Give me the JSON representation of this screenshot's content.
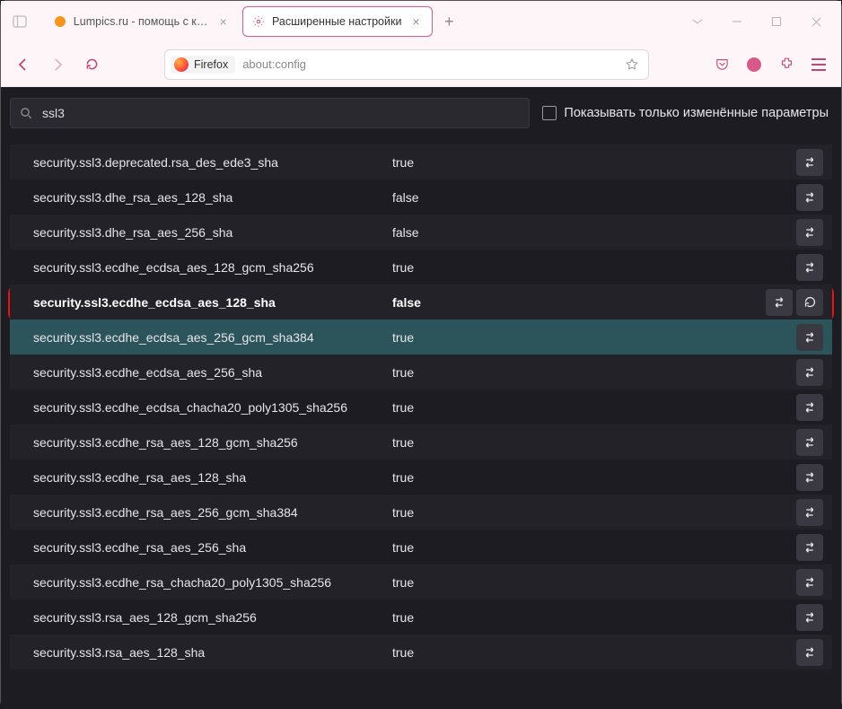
{
  "titlebar": {
    "tabs": [
      {
        "label": "Lumpics.ru - помощь с компь",
        "active": false,
        "favicon_color": "#f7941d"
      },
      {
        "label": "Расширенные настройки",
        "active": true,
        "favicon": "gear"
      }
    ]
  },
  "addressbar": {
    "brand": "Firefox",
    "url": "about:config"
  },
  "config": {
    "search_value": "ssl3",
    "only_modified_label": "Показывать только изменённые параметры",
    "prefs": [
      {
        "name": "security.ssl3.deprecated.rsa_des_ede3_sha",
        "value": "true",
        "modified": false
      },
      {
        "name": "security.ssl3.dhe_rsa_aes_128_sha",
        "value": "false",
        "modified": false
      },
      {
        "name": "security.ssl3.dhe_rsa_aes_256_sha",
        "value": "false",
        "modified": false
      },
      {
        "name": "security.ssl3.ecdhe_ecdsa_aes_128_gcm_sha256",
        "value": "true",
        "modified": false
      },
      {
        "name": "security.ssl3.ecdhe_ecdsa_aes_128_sha",
        "value": "false",
        "modified": true,
        "selected": true
      },
      {
        "name": "security.ssl3.ecdhe_ecdsa_aes_256_gcm_sha384",
        "value": "true",
        "modified": false,
        "hovered": true
      },
      {
        "name": "security.ssl3.ecdhe_ecdsa_aes_256_sha",
        "value": "true",
        "modified": false
      },
      {
        "name": "security.ssl3.ecdhe_ecdsa_chacha20_poly1305_sha256",
        "value": "true",
        "modified": false
      },
      {
        "name": "security.ssl3.ecdhe_rsa_aes_128_gcm_sha256",
        "value": "true",
        "modified": false
      },
      {
        "name": "security.ssl3.ecdhe_rsa_aes_128_sha",
        "value": "true",
        "modified": false
      },
      {
        "name": "security.ssl3.ecdhe_rsa_aes_256_gcm_sha384",
        "value": "true",
        "modified": false
      },
      {
        "name": "security.ssl3.ecdhe_rsa_aes_256_sha",
        "value": "true",
        "modified": false
      },
      {
        "name": "security.ssl3.ecdhe_rsa_chacha20_poly1305_sha256",
        "value": "true",
        "modified": false
      },
      {
        "name": "security.ssl3.rsa_aes_128_gcm_sha256",
        "value": "true",
        "modified": false
      },
      {
        "name": "security.ssl3.rsa_aes_128_sha",
        "value": "true",
        "modified": false
      }
    ]
  }
}
